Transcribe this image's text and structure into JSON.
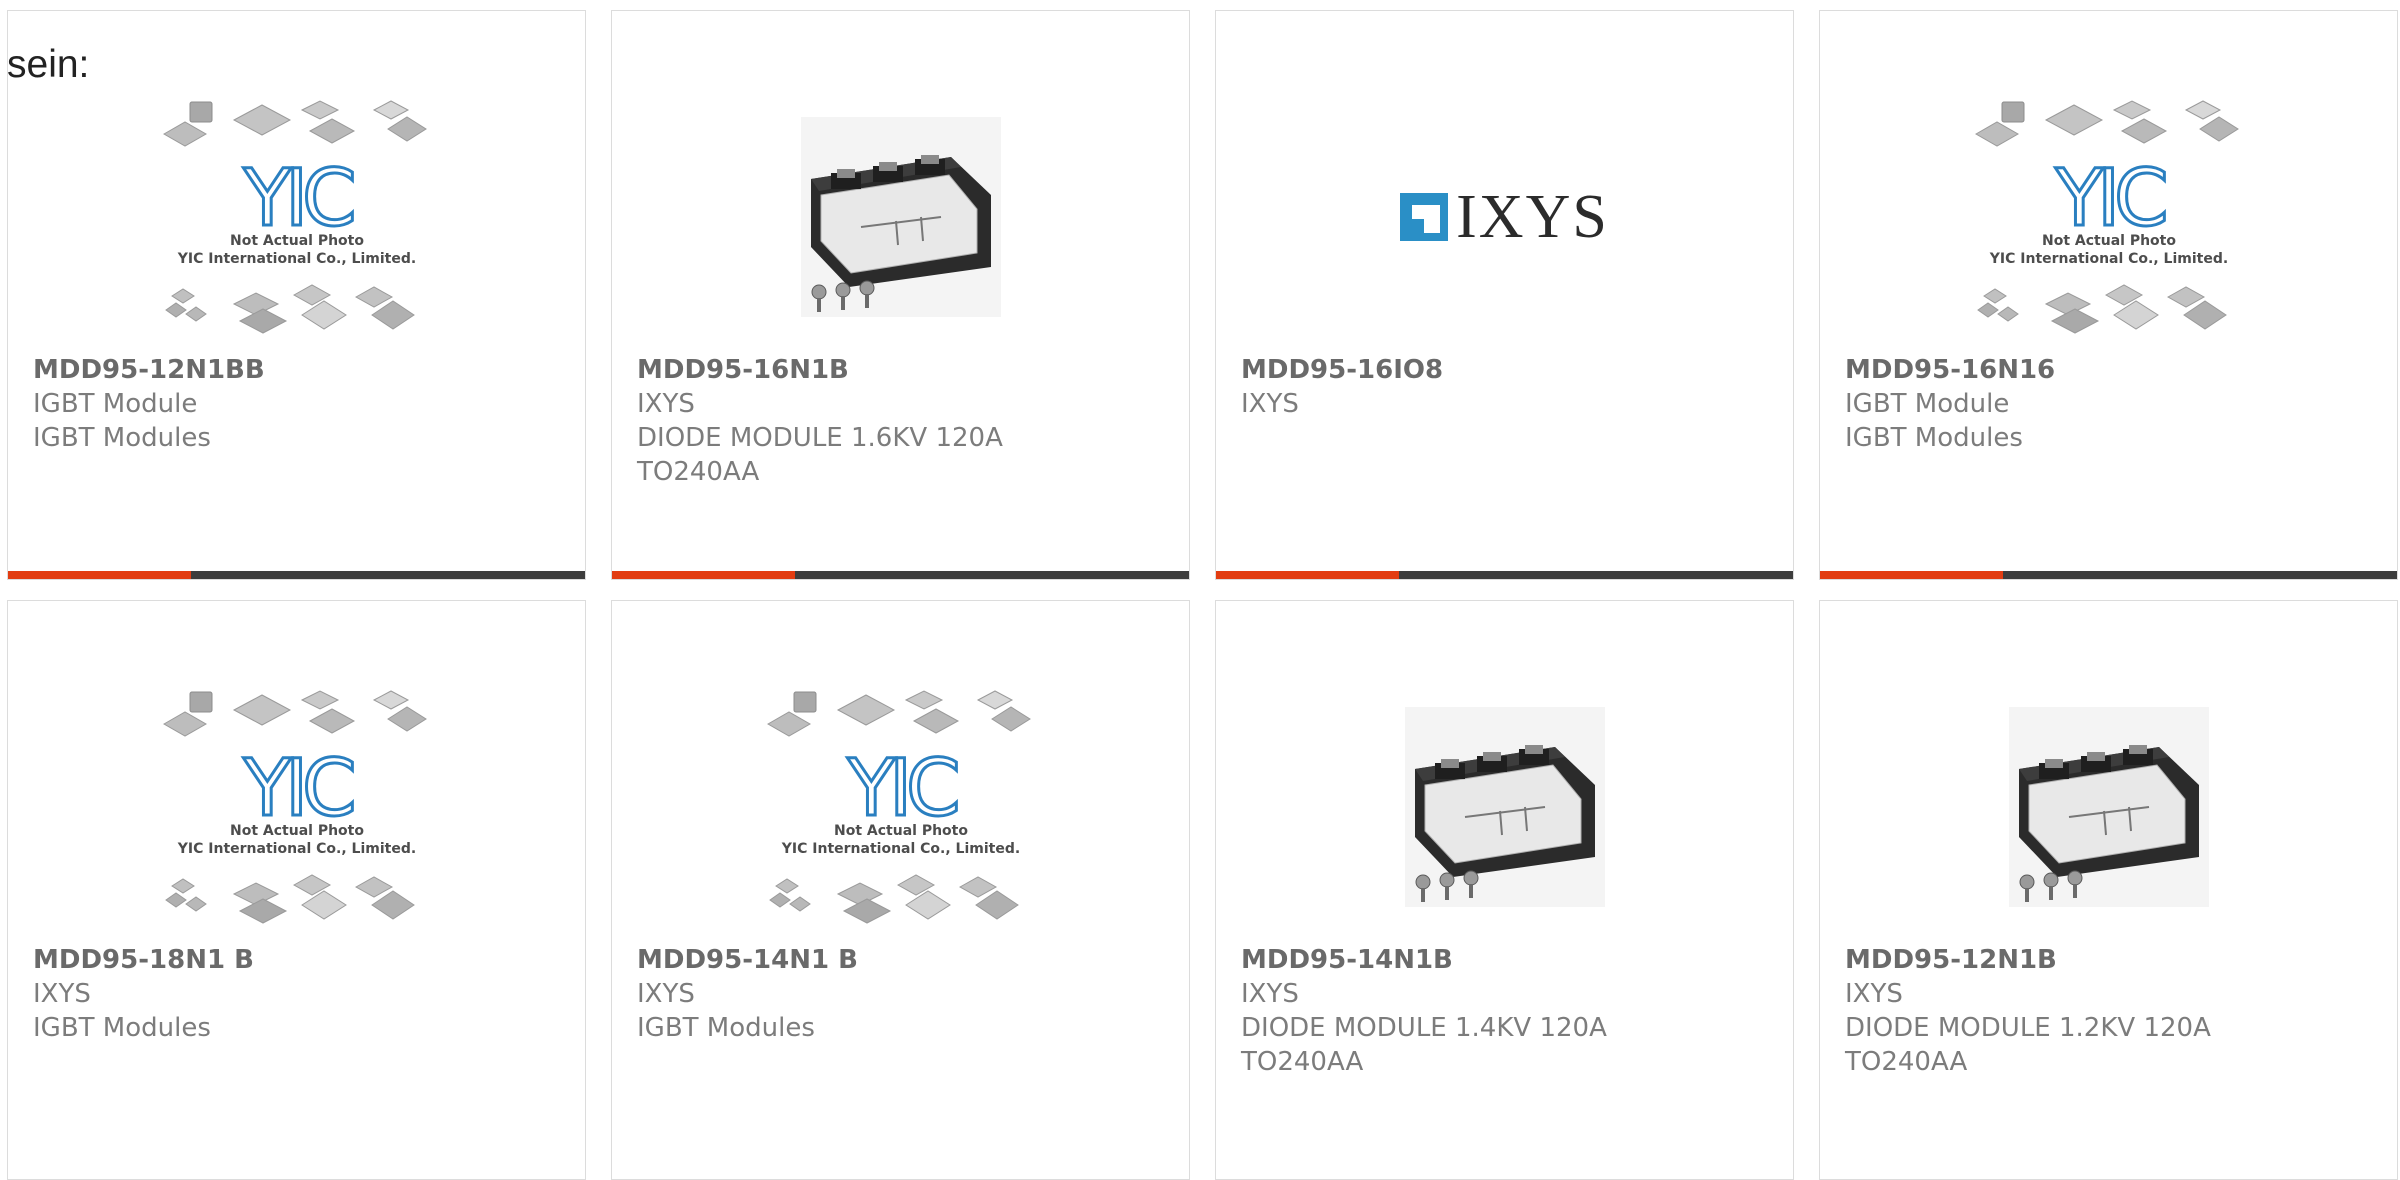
{
  "intro_text": "sein:",
  "placeholder_image": {
    "caption_line1": "Not Actual Photo",
    "caption_line2": "YIC International Co., Limited.",
    "logo_letters": "YIC",
    "logo_color": "#2a7fc0"
  },
  "brand_logo_text": "IXYS",
  "brand_logo_color": "#2a8fc6",
  "accent_color": "#e23d12",
  "products": [
    {
      "part_number": "MDD95-12N1BB",
      "image": "placeholder",
      "lines": [
        "IGBT Module",
        "IGBT Modules"
      ]
    },
    {
      "part_number": "MDD95-16N1B",
      "image": "module-photo",
      "lines": [
        "IXYS",
        "DIODE MODULE 1.6KV 120A",
        "TO240AA"
      ]
    },
    {
      "part_number": "MDD95-16IO8",
      "image": "brand-logo",
      "lines": [
        "IXYS"
      ]
    },
    {
      "part_number": "MDD95-16N16",
      "image": "placeholder",
      "lines": [
        "IGBT Module",
        "IGBT Modules"
      ]
    },
    {
      "part_number": "MDD95-18N1 B",
      "image": "placeholder",
      "lines": [
        "IXYS",
        "IGBT Modules"
      ]
    },
    {
      "part_number": "MDD95-14N1 B",
      "image": "placeholder",
      "lines": [
        "IXYS",
        "IGBT Modules"
      ]
    },
    {
      "part_number": "MDD95-14N1B",
      "image": "module-photo",
      "lines": [
        "IXYS",
        "DIODE MODULE 1.4KV 120A",
        "TO240AA"
      ]
    },
    {
      "part_number": "MDD95-12N1B",
      "image": "module-photo",
      "lines": [
        "IXYS",
        "DIODE MODULE 1.2KV 120A",
        "TO240AA"
      ]
    }
  ]
}
